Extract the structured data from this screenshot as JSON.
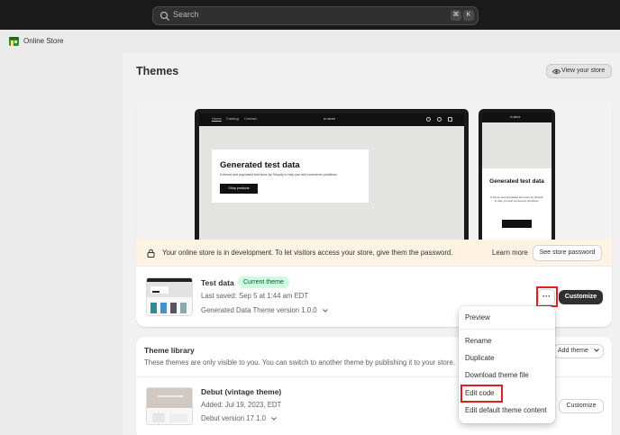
{
  "topbar": {
    "search_placeholder": "Search",
    "shortcut_keys": [
      "⌘",
      "K"
    ]
  },
  "subbar": {
    "title": "Online Store"
  },
  "page": {
    "title": "Themes",
    "view_store_label": "View your store"
  },
  "current_theme": {
    "preview": {
      "desktop_nav": [
        "Home",
        "Catalog",
        "Contact"
      ],
      "store_brand": "in.store",
      "hero_title": "Generated test data",
      "hero_text": "A theme and populated test store by Shopify to help you test commerce primitives.",
      "hero_button": "Shop products"
    },
    "notice": {
      "message": "Your online store is in development. To let visitors access your store, give them the password.",
      "learn_more": "Learn more",
      "see_password": "See store password"
    },
    "name": "Test data",
    "badge": "Current theme",
    "last_saved": "Last saved: Sep 5 at 1:44 am EDT",
    "version": "Generated Data Theme version 1.0.0",
    "more_label": "···",
    "customize_label": "Customize"
  },
  "library": {
    "title": "Theme library",
    "subtitle": "These themes are only visible to you. You can switch to another theme by publishing it to your store.",
    "add_theme_label": "Add theme",
    "themes": [
      {
        "name": "Debut (vintage theme)",
        "added": "Added: Jul 19, 2023, EDT",
        "version": "Debut version 17.1.0",
        "customize_label": "Customize"
      }
    ]
  },
  "actions_menu": {
    "items": [
      "Preview",
      "Rename",
      "Duplicate",
      "Download theme file",
      "Edit code",
      "Edit default theme content"
    ],
    "highlighted": "Edit code"
  },
  "colors": {
    "topbar": "#1a1a1a",
    "notice_bg": "#fff4e4",
    "badge_bg": "#cdfee1",
    "badge_text": "#0c5132",
    "highlight_border": "#e02020",
    "primary_button": "#303030"
  },
  "icons": [
    "search-icon",
    "online-store-icon",
    "eye-icon",
    "lock-icon",
    "chevron-down-icon",
    "more-horizontal-icon"
  ]
}
